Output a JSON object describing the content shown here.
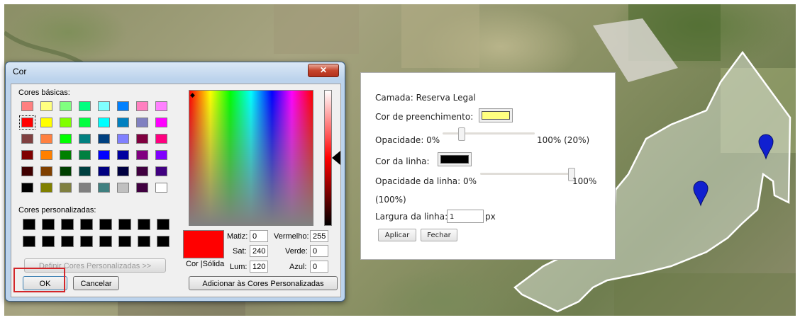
{
  "colors": {
    "map_bg": "#8b8f66",
    "dialog_frame": "#bcd3ec",
    "selected_color": "#ff0000",
    "fill_color": "#ffff80",
    "line_color": "#000000",
    "marker": "#1020d0",
    "highlight": "#d3262a"
  },
  "dialog": {
    "title": "Cor",
    "close_icon": "close-icon",
    "basic_colors_label": "Cores básicas:",
    "basic_colors": [
      [
        "#ff8080",
        "#ffff80",
        "#80ff80",
        "#00ff80",
        "#80ffff",
        "#0080ff",
        "#ff80c0",
        "#ff80ff"
      ],
      [
        "#ff0000",
        "#ffff00",
        "#80ff00",
        "#00ff40",
        "#00ffff",
        "#0080c0",
        "#8080c0",
        "#ff00ff"
      ],
      [
        "#804040",
        "#ff8040",
        "#00ff00",
        "#008080",
        "#004080",
        "#8080ff",
        "#800040",
        "#ff0080"
      ],
      [
        "#800000",
        "#ff8000",
        "#008000",
        "#008040",
        "#0000ff",
        "#0000a0",
        "#800080",
        "#8000ff"
      ],
      [
        "#400000",
        "#804000",
        "#004000",
        "#004040",
        "#000080",
        "#000040",
        "#400040",
        "#400080"
      ],
      [
        "#000000",
        "#808000",
        "#808040",
        "#808080",
        "#408080",
        "#c0c0c0",
        "#400040",
        "#ffffff"
      ]
    ],
    "custom_colors_label": "Cores personalizadas:",
    "define_custom_button": "Definir Cores Personalizadas >>",
    "ok_button": "OK",
    "cancel_button": "Cancelar",
    "color_solid_label": "Cor |Sólida",
    "hue_label": "Matiz:",
    "hue_value": "0",
    "sat_label": "Sat:",
    "sat_value": "240",
    "lum_label": "Lum:",
    "lum_value": "120",
    "red_label": "Vermelho:",
    "red_value": "255",
    "green_label": "Verde:",
    "green_value": "0",
    "blue_label": "Azul:",
    "blue_value": "0",
    "add_custom_button": "Adicionar às Cores Personalizadas"
  },
  "layer_panel": {
    "layer_label": "Camada: Reserva Legal",
    "fill_color_label": "Cor de preenchimento:",
    "opacity_label": "Opacidade: 0%",
    "opacity_max": "100% (20%)",
    "opacity_value": 0.2,
    "line_color_label": "Cor da linha:",
    "line_opacity_label": "Opacidade da linha: 0%",
    "line_opacity_max": "100%",
    "line_opacity_current": "(100%)",
    "line_opacity_value": 1.0,
    "line_width_label": "Largura da linha:",
    "line_width_value": "1",
    "line_width_unit": "px",
    "apply_button": "Aplicar",
    "close_button": "Fechar"
  },
  "map": {
    "marker_icon": "map-pin-icon",
    "markers": 2
  }
}
